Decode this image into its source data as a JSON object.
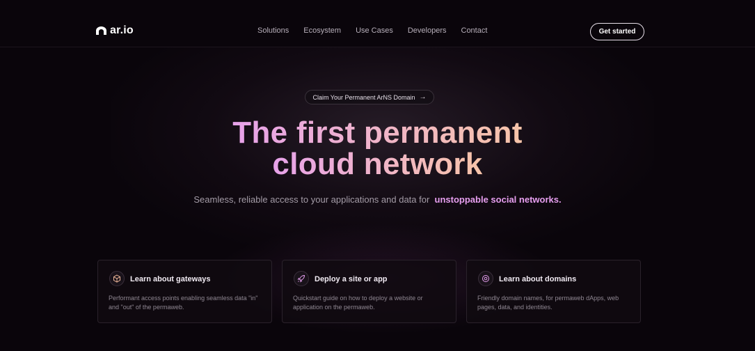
{
  "brand": {
    "name": "ar.io",
    "logo_icon": "arch-icon"
  },
  "nav": {
    "items": [
      {
        "label": "Solutions"
      },
      {
        "label": "Ecosystem"
      },
      {
        "label": "Use Cases"
      },
      {
        "label": "Developers"
      },
      {
        "label": "Contact"
      }
    ],
    "cta": "Get started"
  },
  "hero": {
    "pill": "Claim Your Permanent ArNS Domain",
    "pill_icon": "arrow-right-icon",
    "headline_line1": "The first permanent",
    "headline_line2": "cloud network",
    "subtitle_prefix": "Seamless, reliable access to your applications and data for",
    "subtitle_highlight": "unstoppable social networks."
  },
  "cards": [
    {
      "icon": "cube-icon",
      "title": "Learn about gateways",
      "desc": "Performant access points enabling seamless data \"in\" and \"out\" of the permaweb."
    },
    {
      "icon": "rocket-icon",
      "title": "Deploy a site or app",
      "desc": "Quickstart guide on how to deploy a website or application on the permaweb."
    },
    {
      "icon": "target-icon",
      "title": "Learn about domains",
      "desc": "Friendly domain names, for permaweb dApps, web pages, data, and identities."
    }
  ],
  "colors": {
    "background": "#0a050b",
    "accent_pink": "#e79ff0",
    "accent_peach": "#f7c4a9"
  }
}
